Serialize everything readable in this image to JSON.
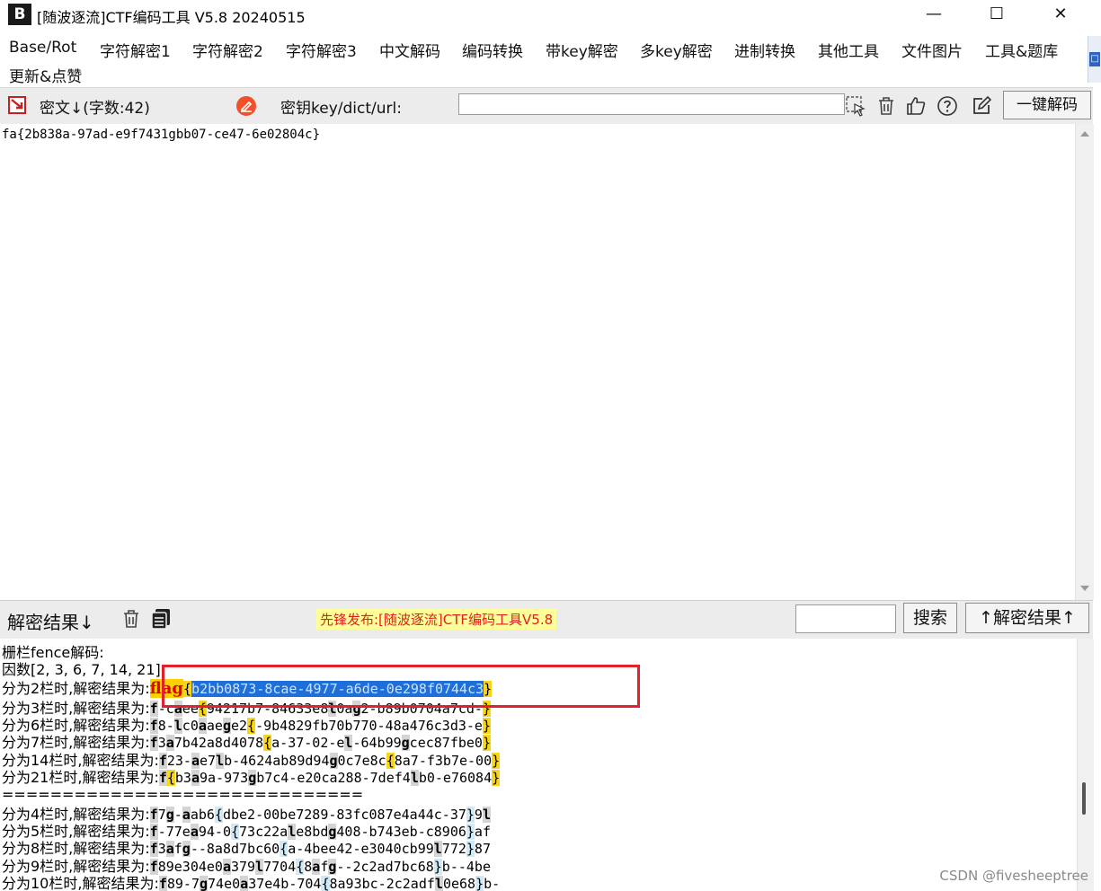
{
  "window": {
    "logo": "B",
    "title": "[随波逐流]CTF编码工具 V5.8 20240515",
    "minimize": "—",
    "maximize": "☐",
    "close": "✕"
  },
  "menu": [
    "Base/Rot",
    "字符解密1",
    "字符解密2",
    "字符解密3",
    "中文解码",
    "编码转换",
    "带key解密",
    "多key解密",
    "进制转换",
    "其他工具",
    "文件图片",
    "工具&题库",
    "更新&点赞"
  ],
  "toolbar": {
    "cipher_label": "密文↓(字数:42)",
    "key_label": "密钥key/dict/url:",
    "key_value": "",
    "decode_button": "一键解码"
  },
  "cipher_text": "fa{2b838a-97ad-e9f7431gbb07-ce47-6e02804c}",
  "result_bar": {
    "label": "解密结果↓",
    "promo": "先锋发布:[随波逐流]CTF编码工具V5.8",
    "search_value": "",
    "search_button": "搜索",
    "up_button": "↑解密结果↑"
  },
  "results": {
    "header": "栅栏fence解码:",
    "factors": "因数[2, 3, 6, 7, 14, 21]:",
    "separator": "=============================="
  },
  "colors": {
    "accent": "#1e6fd9",
    "highlight": "#f7d51d",
    "alert": "#e4212b"
  },
  "watermark": "CSDN @fivesheeptree"
}
